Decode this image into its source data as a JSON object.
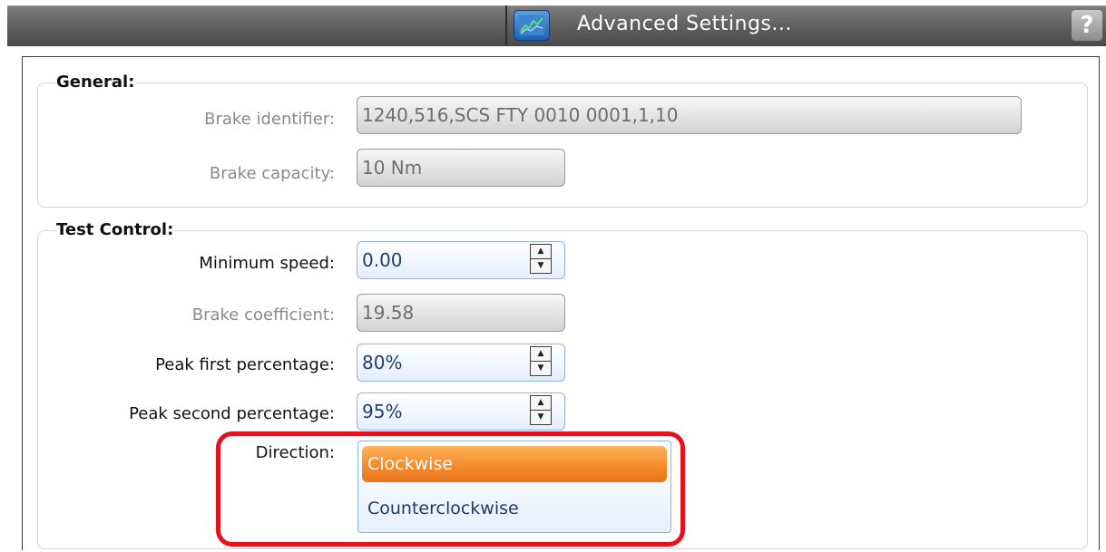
{
  "window": {
    "title": "Advanced Settings...",
    "help_glyph": "?",
    "icon": "settings-chart-icon",
    "colors": {
      "titlebar": "#5e5e5e",
      "icon_blue": "#1d5fb0"
    }
  },
  "general": {
    "title": "General:",
    "brake_identifier": {
      "label": "Brake identifier:",
      "value": "1240,516,SCS FTY 0010 0001,1,10"
    },
    "brake_capacity": {
      "label": "Brake capacity:",
      "value": "10 Nm"
    }
  },
  "test_control": {
    "title": "Test Control:",
    "minimum_speed": {
      "label": "Minimum speed:",
      "value": "0.00"
    },
    "brake_coefficient": {
      "label": "Brake coefficient:",
      "value": "19.58"
    },
    "peak_first": {
      "label": "Peak first percentage:",
      "value": "80%"
    },
    "peak_second": {
      "label": "Peak second percentage:",
      "value": "95%"
    },
    "direction": {
      "label": "Direction:",
      "options": [
        "Clockwise",
        "Counterclockwise"
      ],
      "selected": "Clockwise"
    }
  },
  "colors": {
    "selection": "#f58b2a",
    "highlight_ring": "#e8101c",
    "field_border": "#8fb3e6"
  }
}
